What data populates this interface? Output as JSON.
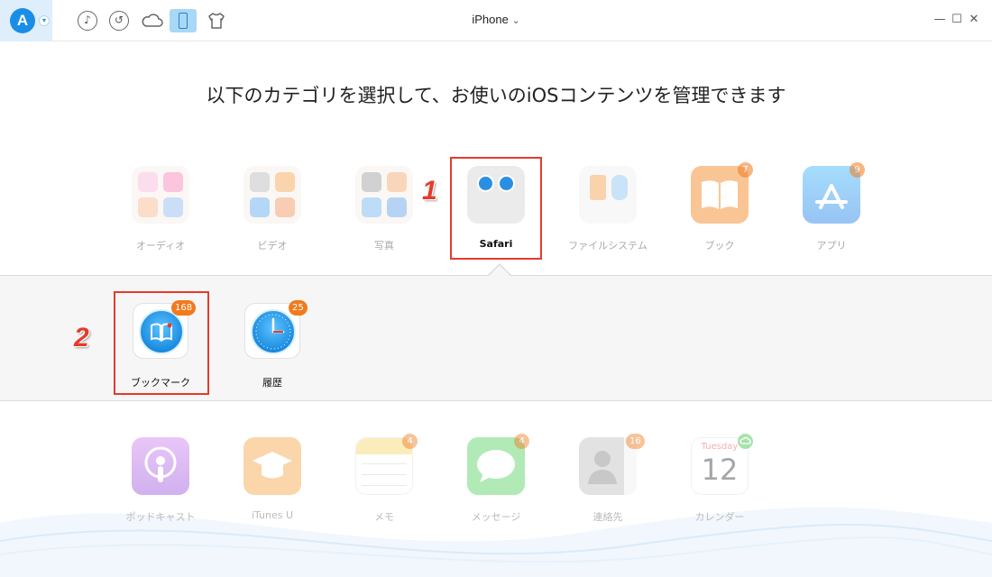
{
  "titlebar": {
    "logo_letter": "A",
    "device_name": "iPhone",
    "device_caret": "⌄",
    "toolbar_icons": [
      "music-icon",
      "history-icon",
      "cloud-icon",
      "phone-icon",
      "shirt-icon"
    ],
    "window_controls": {
      "minimize": "—",
      "maximize": "☐",
      "close": "✕"
    }
  },
  "heading": "以下のカテゴリを選択して、お使いのiOSコンテンツを管理できます",
  "categories": [
    {
      "label": "オーディオ",
      "icon": "audio-icon"
    },
    {
      "label": "ビデオ",
      "icon": "video-icon"
    },
    {
      "label": "写真",
      "icon": "photos-icon"
    },
    {
      "label": "Safari",
      "icon": "safari-folder-icon",
      "selected": true
    },
    {
      "label": "ファイルシステム",
      "icon": "file-system-icon"
    },
    {
      "label": "ブック",
      "icon": "books-icon",
      "badge": "7"
    },
    {
      "label": "アプリ",
      "icon": "app-store-icon",
      "badge": "9"
    }
  ],
  "steps": {
    "one": "1",
    "two": "2"
  },
  "safari_items": [
    {
      "label": "ブックマーク",
      "badge": "168",
      "icon": "bookmarks-icon"
    },
    {
      "label": "履歴",
      "badge": "25",
      "icon": "history-clock-icon"
    }
  ],
  "bottom_items": [
    {
      "label": "ポッドキャスト",
      "icon": "podcast-icon"
    },
    {
      "label": "iTunes U",
      "icon": "itunes-u-icon"
    },
    {
      "label": "メモ",
      "icon": "notes-icon",
      "badge": "4"
    },
    {
      "label": "メッセージ",
      "icon": "messages-icon",
      "badge": "4"
    },
    {
      "label": "連絡先",
      "icon": "contacts-icon",
      "badge": "16"
    },
    {
      "label": "カレンダー",
      "icon": "calendar-icon",
      "calendar_day": "Tuesday",
      "calendar_date": "12"
    }
  ],
  "colors": {
    "accent": "#1a8ee6",
    "highlight": "#e53b2c",
    "badge": "#f07b1e"
  }
}
